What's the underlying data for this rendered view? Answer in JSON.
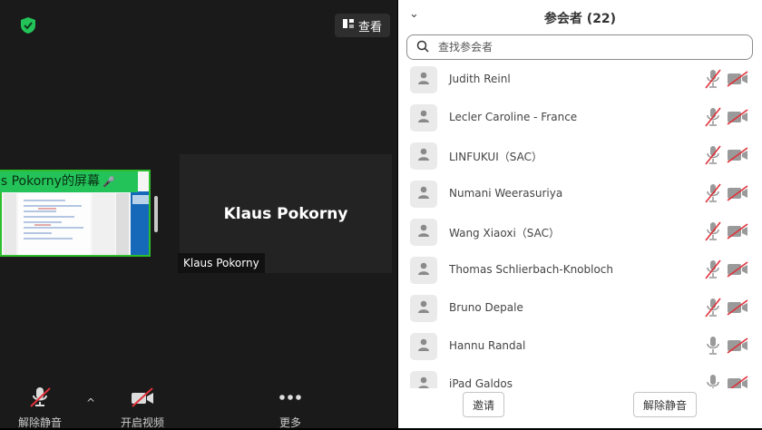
{
  "top_bar": {
    "view_label": "查看"
  },
  "share": {
    "label": "us Pokorny的屏幕",
    "mic_glyph": "🎤"
  },
  "video_tile": {
    "name": "Klaus Pokorny",
    "caption": "Klaus Pokorny"
  },
  "toolbar": {
    "unmute_label": "解除静音",
    "start_video_label": "开启视频",
    "more_label": "更多",
    "caret_glyph": "^"
  },
  "participants": {
    "title": "参会者 (22)",
    "collapse_glyph": "⌄",
    "search_placeholder": "查找参会者",
    "items": [
      {
        "name": "Judith Reinl",
        "mic": "muted",
        "camera": "off"
      },
      {
        "name": "Lecler Caroline - France",
        "mic": "muted",
        "camera": "off"
      },
      {
        "name": "LINFUKUI（SAC）",
        "mic": "muted",
        "camera": "off"
      },
      {
        "name": "Numani Weerasuriya",
        "mic": "muted",
        "camera": "off"
      },
      {
        "name": "Wang Xiaoxi（SAC）",
        "mic": "muted",
        "camera": "off"
      },
      {
        "name": "Thomas Schlierbach-Knobloch",
        "mic": "muted",
        "camera": "off"
      },
      {
        "name": "Bruno Depale",
        "mic": "muted",
        "camera": "off"
      },
      {
        "name": "Hannu Randal",
        "mic": "on",
        "camera": "off"
      },
      {
        "name": "iPad Galdos",
        "mic": "on",
        "camera": "off"
      }
    ],
    "invite_label": "邀请",
    "unmute_all_label": "解除静音"
  },
  "colors": {
    "share_green": "#23c35a",
    "muted_red": "#e0323a",
    "panel_bg": "#ffffff"
  }
}
